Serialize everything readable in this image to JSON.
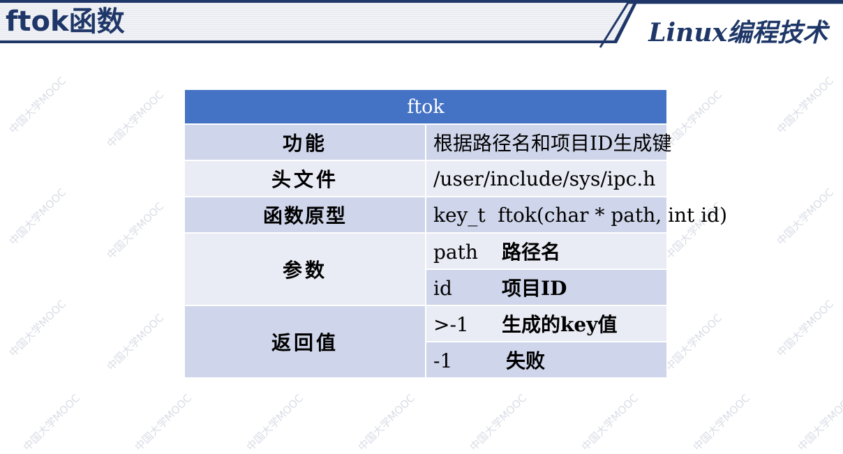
{
  "header": {
    "title": "ftok函数",
    "course": "Linux编程技术"
  },
  "watermark": "中国大学MOOC",
  "table": {
    "heading": "ftok",
    "rows": [
      {
        "label": "功能",
        "value": "根据路径名和项目ID生成键"
      },
      {
        "label": "头文件",
        "value": "/user/include/sys/ipc.h"
      },
      {
        "label": "函数原型",
        "value": "key_t  ftok(char * path, int id)"
      }
    ],
    "params": {
      "label": "参数",
      "items": [
        {
          "name": "path",
          "desc": "路径名"
        },
        {
          "name": "id",
          "desc": "项目ID"
        }
      ]
    },
    "returns": {
      "label": "返回值",
      "items": [
        {
          "name": ">-1",
          "desc": "生成的key值"
        },
        {
          "name": "-1",
          "desc": "失败"
        }
      ]
    }
  },
  "colors": {
    "header_blue": "#1f3768",
    "table_head": "#4472c4",
    "row_dark": "#cfd5ea",
    "row_light": "#e9ebf5"
  }
}
